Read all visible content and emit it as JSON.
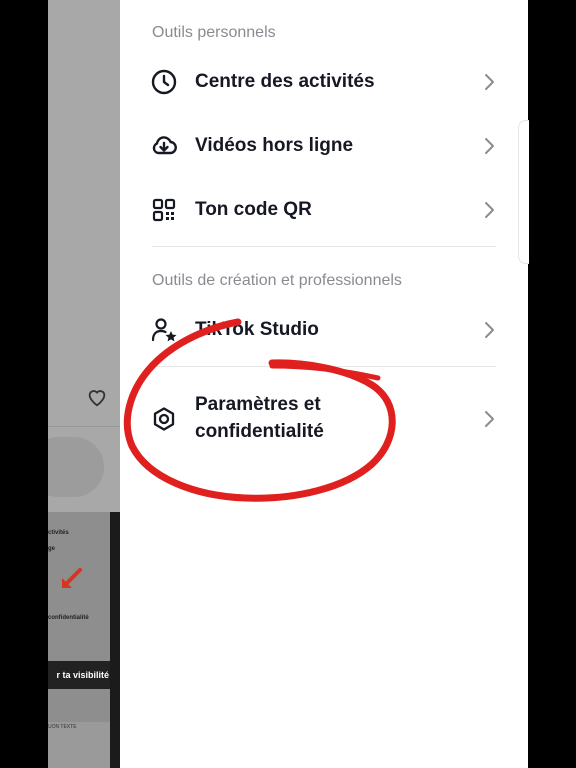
{
  "drawer": {
    "sections": [
      {
        "title": "Outils personnels"
      },
      {
        "title": "Outils de création et professionnels"
      }
    ],
    "items": {
      "activity_center": "Centre des activités",
      "offline_videos": "Vidéos hors ligne",
      "qr_code": "Ton code QR",
      "tiktok_studio": "TikTok Studio",
      "settings_line1": "Paramètres et",
      "settings_line2": "confidentialité"
    }
  },
  "background": {
    "thumb_lines": [
      "ctivités",
      "ge",
      "confidentialité"
    ],
    "thumb_banner": "r ta visibilité",
    "thumb_bottom": "UON TEXTE"
  },
  "colors": {
    "annotation_red": "#e0201e",
    "text_primary": "#161823",
    "text_secondary": "#8a8b91"
  },
  "icons": {
    "activity": "clock-icon",
    "offline": "cloud-download-icon",
    "qr": "qr-code-icon",
    "studio": "person-star-icon",
    "settings": "gear-icon",
    "chevron": "chevron-right-icon"
  }
}
